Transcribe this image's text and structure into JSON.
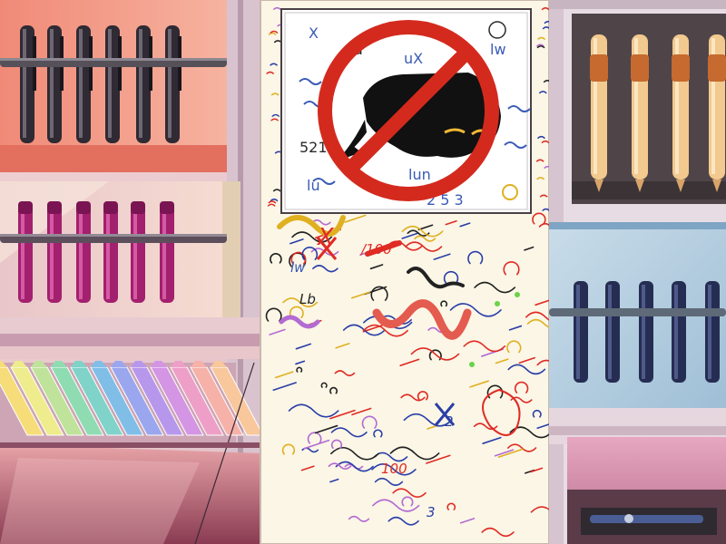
{
  "scene": {
    "kind": "illustration",
    "subject": "stationery shop wall with a test-paper board and a no-drawing sign"
  },
  "sign": {
    "icon": "no-drawing-prohibition-icon",
    "ring_color": "#d42a1e",
    "doodles": [
      "X",
      "a",
      "uX",
      "lw",
      "521",
      "lu",
      "2 5 3",
      "lun"
    ]
  },
  "test_paper": {
    "scribbles": [
      "/100",
      "lw",
      "Lb",
      "X",
      "100",
      "2",
      "3"
    ]
  },
  "palette": {
    "wall_pink": "#e8b3b7",
    "shelf_salmon": "#f29982",
    "paper": "#fbf6e6",
    "crayon_colors": [
      "#f7dd79",
      "#eeec8c",
      "#bfe39a",
      "#8fdcb2",
      "#7fd3c9",
      "#80bee8",
      "#9aa7ee",
      "#b797ec",
      "#d395e4",
      "#ee9fc7",
      "#f6b1a9",
      "#f8c79c"
    ]
  }
}
